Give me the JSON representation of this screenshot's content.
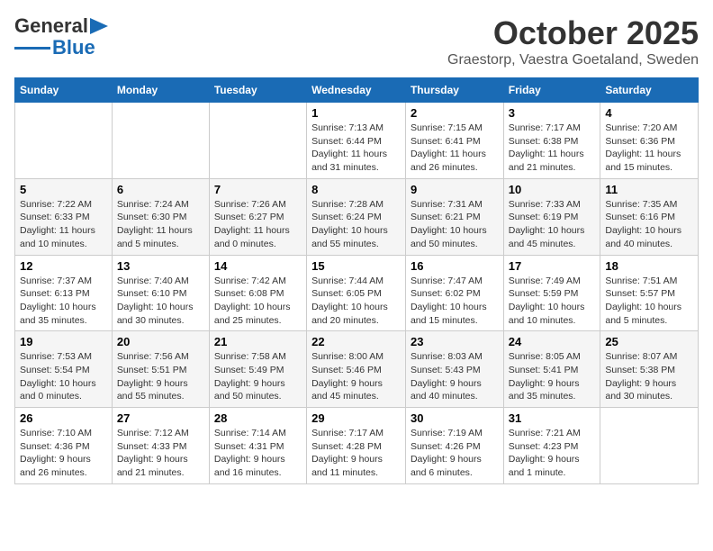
{
  "logo": {
    "text1": "General",
    "text2": "Blue"
  },
  "title": "October 2025",
  "subtitle": "Graestorp, Vaestra Goetaland, Sweden",
  "headers": [
    "Sunday",
    "Monday",
    "Tuesday",
    "Wednesday",
    "Thursday",
    "Friday",
    "Saturday"
  ],
  "weeks": [
    [
      {
        "day": "",
        "info": ""
      },
      {
        "day": "",
        "info": ""
      },
      {
        "day": "",
        "info": ""
      },
      {
        "day": "1",
        "info": "Sunrise: 7:13 AM\nSunset: 6:44 PM\nDaylight: 11 hours and 31 minutes."
      },
      {
        "day": "2",
        "info": "Sunrise: 7:15 AM\nSunset: 6:41 PM\nDaylight: 11 hours and 26 minutes."
      },
      {
        "day": "3",
        "info": "Sunrise: 7:17 AM\nSunset: 6:38 PM\nDaylight: 11 hours and 21 minutes."
      },
      {
        "day": "4",
        "info": "Sunrise: 7:20 AM\nSunset: 6:36 PM\nDaylight: 11 hours and 15 minutes."
      }
    ],
    [
      {
        "day": "5",
        "info": "Sunrise: 7:22 AM\nSunset: 6:33 PM\nDaylight: 11 hours and 10 minutes."
      },
      {
        "day": "6",
        "info": "Sunrise: 7:24 AM\nSunset: 6:30 PM\nDaylight: 11 hours and 5 minutes."
      },
      {
        "day": "7",
        "info": "Sunrise: 7:26 AM\nSunset: 6:27 PM\nDaylight: 11 hours and 0 minutes."
      },
      {
        "day": "8",
        "info": "Sunrise: 7:28 AM\nSunset: 6:24 PM\nDaylight: 10 hours and 55 minutes."
      },
      {
        "day": "9",
        "info": "Sunrise: 7:31 AM\nSunset: 6:21 PM\nDaylight: 10 hours and 50 minutes."
      },
      {
        "day": "10",
        "info": "Sunrise: 7:33 AM\nSunset: 6:19 PM\nDaylight: 10 hours and 45 minutes."
      },
      {
        "day": "11",
        "info": "Sunrise: 7:35 AM\nSunset: 6:16 PM\nDaylight: 10 hours and 40 minutes."
      }
    ],
    [
      {
        "day": "12",
        "info": "Sunrise: 7:37 AM\nSunset: 6:13 PM\nDaylight: 10 hours and 35 minutes."
      },
      {
        "day": "13",
        "info": "Sunrise: 7:40 AM\nSunset: 6:10 PM\nDaylight: 10 hours and 30 minutes."
      },
      {
        "day": "14",
        "info": "Sunrise: 7:42 AM\nSunset: 6:08 PM\nDaylight: 10 hours and 25 minutes."
      },
      {
        "day": "15",
        "info": "Sunrise: 7:44 AM\nSunset: 6:05 PM\nDaylight: 10 hours and 20 minutes."
      },
      {
        "day": "16",
        "info": "Sunrise: 7:47 AM\nSunset: 6:02 PM\nDaylight: 10 hours and 15 minutes."
      },
      {
        "day": "17",
        "info": "Sunrise: 7:49 AM\nSunset: 5:59 PM\nDaylight: 10 hours and 10 minutes."
      },
      {
        "day": "18",
        "info": "Sunrise: 7:51 AM\nSunset: 5:57 PM\nDaylight: 10 hours and 5 minutes."
      }
    ],
    [
      {
        "day": "19",
        "info": "Sunrise: 7:53 AM\nSunset: 5:54 PM\nDaylight: 10 hours and 0 minutes."
      },
      {
        "day": "20",
        "info": "Sunrise: 7:56 AM\nSunset: 5:51 PM\nDaylight: 9 hours and 55 minutes."
      },
      {
        "day": "21",
        "info": "Sunrise: 7:58 AM\nSunset: 5:49 PM\nDaylight: 9 hours and 50 minutes."
      },
      {
        "day": "22",
        "info": "Sunrise: 8:00 AM\nSunset: 5:46 PM\nDaylight: 9 hours and 45 minutes."
      },
      {
        "day": "23",
        "info": "Sunrise: 8:03 AM\nSunset: 5:43 PM\nDaylight: 9 hours and 40 minutes."
      },
      {
        "day": "24",
        "info": "Sunrise: 8:05 AM\nSunset: 5:41 PM\nDaylight: 9 hours and 35 minutes."
      },
      {
        "day": "25",
        "info": "Sunrise: 8:07 AM\nSunset: 5:38 PM\nDaylight: 9 hours and 30 minutes."
      }
    ],
    [
      {
        "day": "26",
        "info": "Sunrise: 7:10 AM\nSunset: 4:36 PM\nDaylight: 9 hours and 26 minutes."
      },
      {
        "day": "27",
        "info": "Sunrise: 7:12 AM\nSunset: 4:33 PM\nDaylight: 9 hours and 21 minutes."
      },
      {
        "day": "28",
        "info": "Sunrise: 7:14 AM\nSunset: 4:31 PM\nDaylight: 9 hours and 16 minutes."
      },
      {
        "day": "29",
        "info": "Sunrise: 7:17 AM\nSunset: 4:28 PM\nDaylight: 9 hours and 11 minutes."
      },
      {
        "day": "30",
        "info": "Sunrise: 7:19 AM\nSunset: 4:26 PM\nDaylight: 9 hours and 6 minutes."
      },
      {
        "day": "31",
        "info": "Sunrise: 7:21 AM\nSunset: 4:23 PM\nDaylight: 9 hours and 1 minute."
      },
      {
        "day": "",
        "info": ""
      }
    ]
  ]
}
